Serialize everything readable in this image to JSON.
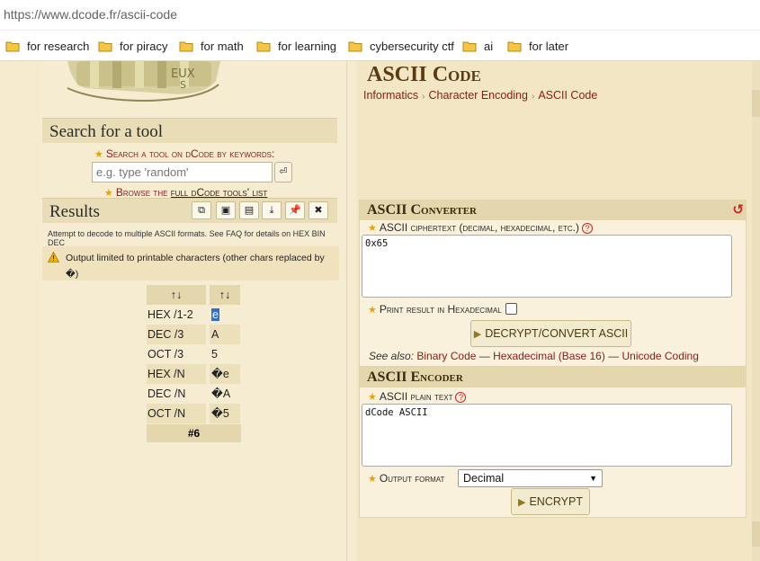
{
  "browser": {
    "url_host": "https://www.dcode.fr",
    "url_path": "/ascii-code",
    "bookmarks": [
      "for research",
      "for piracy",
      "for math",
      "for learning",
      "cybersecurity ctf",
      "ai",
      "for later"
    ]
  },
  "sidebar": {
    "search_title": "Search for a tool",
    "search_label": "Search a tool on dCode by keywords:",
    "search_placeholder": "e.g. type 'random'",
    "browse_prefix": "Browse the ",
    "browse_link": "full dCode tools' list",
    "results_title": "Results",
    "info_text": "Attempt to decode to multiple ASCII formats. See FAQ for details on HEX BIN DEC",
    "warning_text": "Output limited to printable characters (other chars replaced by �)",
    "table": {
      "headers": [
        "↑↓",
        "↑↓"
      ],
      "rows": [
        {
          "label": "HEX /1-2",
          "value": "e"
        },
        {
          "label": "DEC /3",
          "value": "A"
        },
        {
          "label": "OCT /3",
          "value": "5"
        },
        {
          "label": "HEX /N",
          "value": "�e"
        },
        {
          "label": "DEC /N",
          "value": "�A"
        },
        {
          "label": "OCT /N",
          "value": "�5"
        }
      ],
      "footer": "#6"
    }
  },
  "main": {
    "title": "ASCII Code",
    "breadcrumb": [
      "Informatics",
      "Character Encoding",
      "ASCII Code"
    ],
    "converter": {
      "heading": "ASCII Converter",
      "field_label": "ASCII ciphertext (decimal, hexadecimal, etc.)",
      "field_value": "0x65",
      "hex_checkbox_label": "Print result in Hexadecimal",
      "button": "DECRYPT/CONVERT ASCII",
      "see_also_label": "See also:",
      "see_also_links": [
        "Binary Code",
        "Hexadecimal (Base 16)",
        "Unicode Coding"
      ]
    },
    "encoder": {
      "heading": "ASCII Encoder",
      "field_label": "ASCII plain text",
      "field_value": "dCode ASCII",
      "format_label": "Output format",
      "format_value": "Decimal",
      "button": "ENCRYPT"
    }
  },
  "colors": {
    "accent_red": "#8b1a1a",
    "title_brown": "#5b3a12",
    "selection_blue": "#2d6fd2"
  }
}
